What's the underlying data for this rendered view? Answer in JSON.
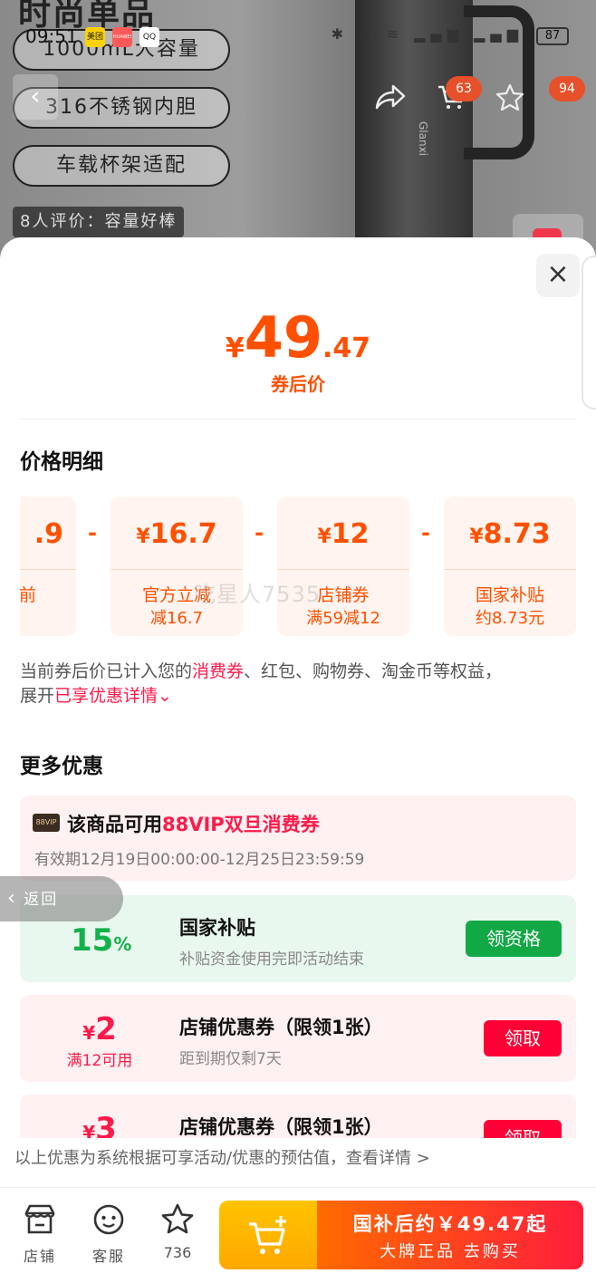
{
  "background": {
    "top_title": "时尚单品",
    "pills": [
      "1000mL大容量",
      "316不锈钢内胆",
      "车载杯架适配"
    ],
    "review_tag": "8人评价：容量好棒",
    "cup_brand": "Glanxi",
    "cart_badge": "63",
    "more_badge": "94"
  },
  "status_bar": {
    "time": "09:51",
    "apps": [
      "美团",
      "HUAWEI",
      "QQ"
    ],
    "battery": "87"
  },
  "sheet": {
    "close_label": "×",
    "price": {
      "currency": "¥",
      "integer": "49",
      "decimal": ".47",
      "label": "券后价"
    },
    "breakdown": {
      "title": "价格明细",
      "cards": [
        {
          "value": ".9",
          "line1": "前",
          "line2": ""
        },
        {
          "currency": "¥",
          "value": "16.7",
          "line1": "官方立减",
          "line2": "减16.7"
        },
        {
          "currency": "¥",
          "value": "12",
          "line1": "店铺券",
          "line2": "满59减12"
        },
        {
          "currency": "¥",
          "value": "8.73",
          "line1": "国家补贴",
          "line2": "约8.73元"
        }
      ],
      "operator": "-",
      "watermark": "吃星人7535"
    },
    "note": {
      "p1": "当前券后价已计入您的",
      "hl1": "消费券",
      "p2": "、红包、购物券、淘金币等权益，",
      "p3": "展开",
      "hl2": "已享优惠详情",
      "chevron": "⌄"
    },
    "more": {
      "title": "更多优惠",
      "vip": {
        "tag": "88VIP",
        "title_prefix": "该商品可用",
        "title_highlight": "88VIP双旦消费券",
        "validity": "有效期12月19日00:00:00-12月25日23:59:59"
      },
      "gov": {
        "percent": "15",
        "percent_sign": "%",
        "title": "国家补贴",
        "subtitle": "补贴资金使用完即活动结束",
        "button": "领资格"
      },
      "coupons": [
        {
          "currency": "¥",
          "amount": "2",
          "condition": "满12可用",
          "title": "店铺优惠券（限领1张）",
          "subtitle": "距到期仅剩7天",
          "button": "领取"
        },
        {
          "currency": "¥",
          "amount": "3",
          "condition": "",
          "title": "店铺优惠券（限领1张）",
          "subtitle": "",
          "button": "领取"
        }
      ]
    },
    "disclaimer": "以上优惠为系统根据可享活动/优惠的预估值，查看详情 >"
  },
  "float_back": {
    "label": "返回"
  },
  "bottom_bar": {
    "tabs": [
      {
        "label": "店铺",
        "icon": "shop-icon"
      },
      {
        "label": "客服",
        "icon": "service-icon"
      },
      {
        "label": "736",
        "icon": "star-icon"
      }
    ],
    "cart_icon": "cart-plus-icon",
    "buy_line1": "国补后约￥49.47起",
    "buy_line2": "大牌正品 去购买"
  },
  "colors": {
    "accent_orange": "#ff5000",
    "accent_red": "#ff0036",
    "green": "#11a845"
  }
}
